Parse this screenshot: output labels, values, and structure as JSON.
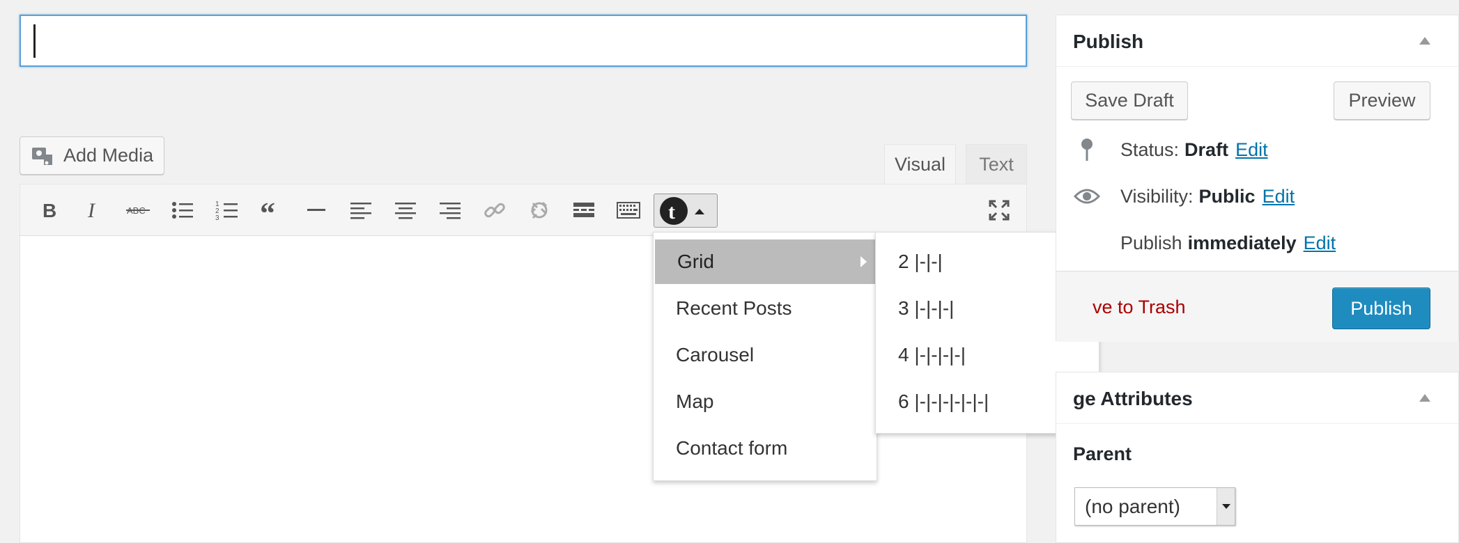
{
  "title_input": {
    "value": ""
  },
  "add_media": {
    "label": "Add Media"
  },
  "editor_tabs": {
    "visual": "Visual",
    "text": "Text"
  },
  "toolbar": {
    "buttons": [
      "bold-icon",
      "italic-icon",
      "strikethrough-icon",
      "bulleted-list-icon",
      "numbered-list-icon",
      "blockquote-icon",
      "horizontal-line-icon",
      "align-left-icon",
      "align-center-icon",
      "align-right-icon",
      "insert-link-icon",
      "remove-link-icon",
      "read-more-icon",
      "toolbar-toggle-icon",
      "shortcode-menu-icon",
      "fullscreen-icon"
    ]
  },
  "shortcode_menu": {
    "items": [
      {
        "label": "Grid",
        "has_submenu": true,
        "active": true
      },
      {
        "label": "Recent Posts"
      },
      {
        "label": "Carousel"
      },
      {
        "label": "Map"
      },
      {
        "label": "Contact form"
      }
    ],
    "submenu": [
      {
        "label": "2 |-|-|"
      },
      {
        "label": "3 |-|-|-|"
      },
      {
        "label": "4 |-|-|-|-|"
      },
      {
        "label": "6 |-|-|-|-|-|-|"
      }
    ]
  },
  "publish_box": {
    "title": "Publish",
    "save_draft": "Save Draft",
    "preview": "Preview",
    "status": {
      "label": "Status:",
      "value": "Draft",
      "edit": "Edit"
    },
    "visibility": {
      "label": "Visibility:",
      "value": "Public",
      "edit": "Edit"
    },
    "schedule": {
      "label": "Publish",
      "value": "immediately",
      "edit": "Edit"
    },
    "trash": "ve to Trash",
    "publish_button": "Publish"
  },
  "page_attributes": {
    "title": "ge Attributes",
    "parent_label": "Parent",
    "parent_value": "(no parent)"
  },
  "colors": {
    "primary": "#1e8cbe",
    "link": "#0073aa",
    "trash": "#a00000",
    "focus": "#5b9dd9"
  }
}
